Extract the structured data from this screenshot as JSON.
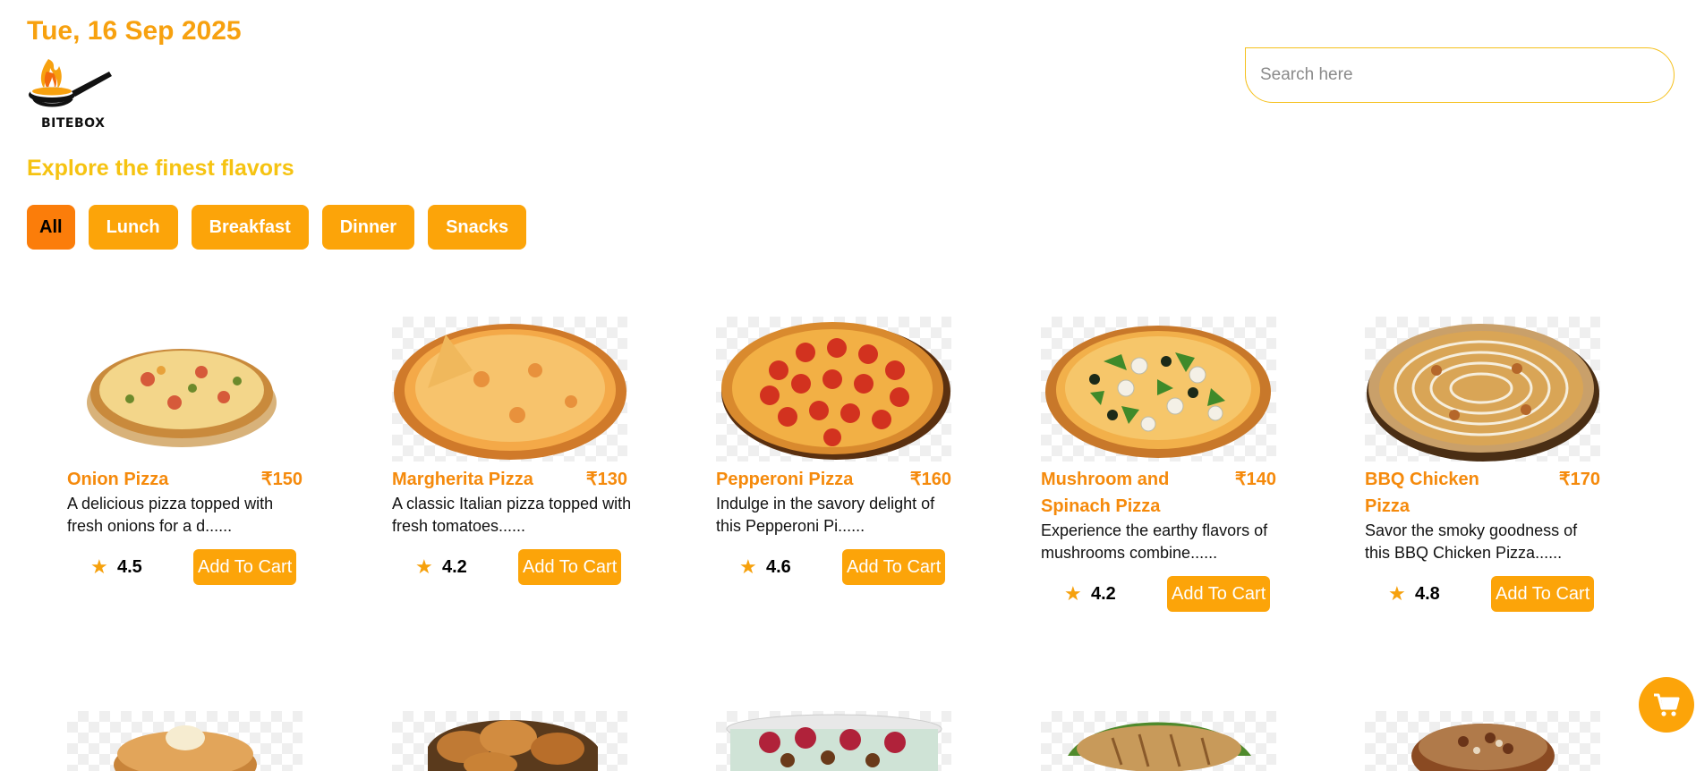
{
  "header": {
    "date": "Tue, 16 Sep 2025",
    "logo_text": "BITEBOX",
    "tagline": "Explore the finest flavors"
  },
  "search": {
    "placeholder": "Search here"
  },
  "categories": [
    {
      "label": "All",
      "active": true
    },
    {
      "label": "Lunch",
      "active": false
    },
    {
      "label": "Breakfast",
      "active": false
    },
    {
      "label": "Dinner",
      "active": false
    },
    {
      "label": "Snacks",
      "active": false
    }
  ],
  "products": [
    {
      "name": "Onion Pizza",
      "price": "₹150",
      "desc": "A delicious pizza topped with fresh onions for a d......",
      "rating": "4.5",
      "button": "Add To Cart",
      "icon": "onion-pizza-image"
    },
    {
      "name": "Margherita Pizza",
      "price": "₹130",
      "desc": "A classic Italian pizza topped with fresh tomatoes......",
      "rating": "4.2",
      "button": "Add To Cart",
      "icon": "margherita-pizza-image"
    },
    {
      "name": "Pepperoni Pizza",
      "price": "₹160",
      "desc": "Indulge in the savory delight of this Pepperoni Pi......",
      "rating": "4.6",
      "button": "Add To Cart",
      "icon": "pepperoni-pizza-image"
    },
    {
      "name": "Mushroom and Spinach Pizza",
      "price": "₹140",
      "desc": "Experience the earthy flavors of mushrooms combine......",
      "rating": "4.2",
      "button": "Add To Cart",
      "icon": "mushroom-spinach-pizza-image"
    },
    {
      "name": "BBQ Chicken Pizza",
      "price": "₹170",
      "desc": "Savor the smoky goodness of this BBQ Chicken Pizza......",
      "rating": "4.8",
      "button": "Add To Cart",
      "icon": "bbq-chicken-pizza-image"
    }
  ],
  "colors": {
    "accent": "#fca409",
    "active": "#fb7d0a",
    "title": "#f58a0c",
    "date": "#f7a10f",
    "tagline": "#f6c311"
  },
  "icons": {
    "star": "star-icon",
    "cart": "cart-icon"
  }
}
